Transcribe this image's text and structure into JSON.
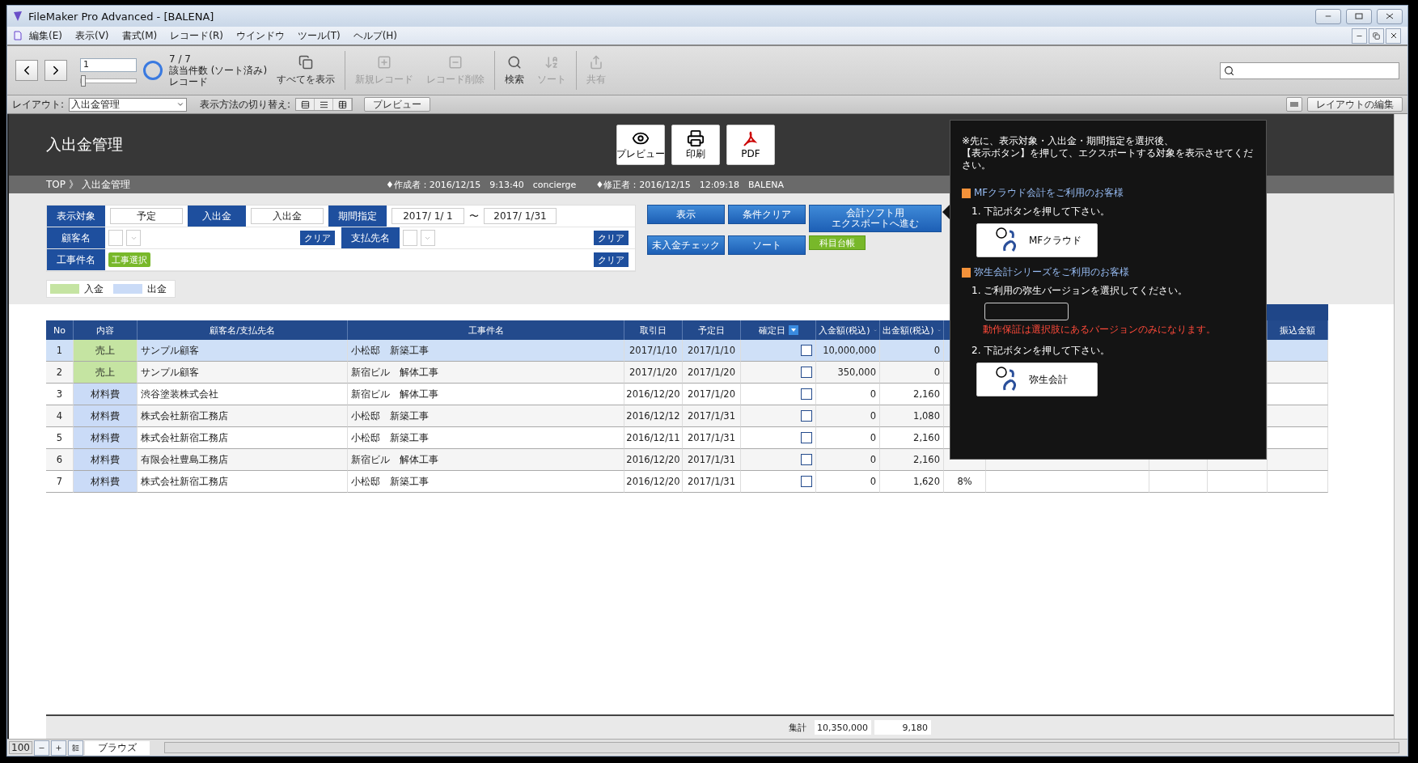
{
  "window": {
    "title": "FileMaker Pro Advanced - [BALENA]"
  },
  "menu": [
    "編集(E)",
    "表示(V)",
    "書式(M)",
    "レコード(R)",
    "ウインドウ",
    "ツール(T)",
    "ヘルプ(H)"
  ],
  "toolbar": {
    "record": "1",
    "slider": {
      "level": 0
    },
    "found": "7 / 7",
    "found_label": "該当件数 (ソート済み)",
    "unit": "レコード",
    "buttons": [
      {
        "kind": "showall",
        "label": "すべてを表示",
        "disabled": false
      },
      {
        "kind": "new",
        "label": "新規レコード",
        "disabled": true
      },
      {
        "kind": "delete",
        "label": "レコード削除",
        "disabled": true
      },
      {
        "kind": "find",
        "label": "検索",
        "disabled": false
      },
      {
        "kind": "sort",
        "label": "ソート",
        "disabled": true
      },
      {
        "kind": "share",
        "label": "共有",
        "disabled": true
      }
    ]
  },
  "layout_bar": {
    "layout_label": "レイアウト:",
    "layout": "入出金管理",
    "view_label": "表示方法の切り替え:",
    "preview": "プレビュー",
    "edit": "レイアウトの編集"
  },
  "header": {
    "title": "入出金管理",
    "actions": [
      {
        "kind": "preview",
        "label": "プレビュー"
      },
      {
        "kind": "print",
        "label": "印刷"
      },
      {
        "kind": "pdf",
        "label": "PDF"
      }
    ]
  },
  "breadcrumb": {
    "path": "TOP 》 入出金管理",
    "created": "♦作成者：2016/12/15　9:13:40　concierge",
    "modified": "♦修正者：2016/12/15　12:09:18　BALENA"
  },
  "filters": {
    "target_label": "表示対象",
    "target": "予定",
    "io_label": "入出金",
    "io": "入出金",
    "period_label": "期間指定",
    "from": "2017/ 1/ 1",
    "tilde": "〜",
    "to": "2017/ 1/31",
    "customer_label": "顧客名",
    "payee_label": "支払先名",
    "project_label": "工事件名",
    "project_button": "工事選択",
    "clear": [
      "クリア",
      "クリア",
      "クリア"
    ]
  },
  "actions": [
    {
      "kind": "blue",
      "lines": [
        "表示"
      ]
    },
    {
      "kind": "blue",
      "lines": [
        "条件クリア"
      ]
    },
    {
      "kind": "wide",
      "lines": [
        "会計ソフト用",
        "エクスポートへ進む"
      ]
    },
    {
      "kind": "blue",
      "lines": [
        "未入金チェック"
      ]
    },
    {
      "kind": "blue",
      "lines": [
        "ソート"
      ]
    },
    {
      "kind": "green",
      "lines": [
        "科目台帳"
      ]
    }
  ],
  "legend": [
    {
      "label": "入金",
      "color": "#c5e4a2"
    },
    {
      "label": "出金",
      "color": "#cadbf7"
    }
  ],
  "table": {
    "columns": [
      "No",
      "内容",
      "顧客名/支払先名",
      "工事件名",
      "取引日",
      "予定日",
      "確定日",
      "入金額(税込)",
      "出金額(税込)"
    ],
    "last_column": "振込金額",
    "rows": [
      {
        "no": "1",
        "type": "売上",
        "color": "#c5e4a2",
        "party": "サンプル顧客",
        "project": "小松邸　新築工事",
        "trade": "2017/1/10",
        "due": "2017/1/10",
        "checked": false,
        "income": "10,000,000",
        "expense": "0",
        "selected": true
      },
      {
        "no": "2",
        "type": "売上",
        "color": "#c5e4a2",
        "party": "サンプル顧客",
        "project": "新宿ビル　解体工事",
        "trade": "2017/1/20",
        "due": "2017/1/20",
        "checked": false,
        "income": "350,000",
        "expense": "0",
        "selected": false
      },
      {
        "no": "3",
        "type": "材料費",
        "color": "#cadbf7",
        "party": "渋谷塗装株式会社",
        "project": "新宿ビル　解体工事",
        "trade": "2016/12/20",
        "due": "2017/1/20",
        "checked": false,
        "income": "0",
        "expense": "2,160",
        "selected": false
      },
      {
        "no": "4",
        "type": "材料費",
        "color": "#cadbf7",
        "party": "株式会社新宿工務店",
        "project": "小松邸　新築工事",
        "trade": "2016/12/12",
        "due": "2017/1/31",
        "checked": false,
        "income": "0",
        "expense": "1,080",
        "selected": false
      },
      {
        "no": "5",
        "type": "材料費",
        "color": "#cadbf7",
        "party": "株式会社新宿工務店",
        "project": "小松邸　新築工事",
        "trade": "2016/12/11",
        "due": "2017/1/31",
        "checked": false,
        "income": "0",
        "expense": "2,160",
        "selected": false
      },
      {
        "no": "6",
        "type": "材料費",
        "color": "#cadbf7",
        "party": "有限会社豊島工務店",
        "project": "新宿ビル　解体工事",
        "trade": "2016/12/20",
        "due": "2017/1/31",
        "checked": false,
        "income": "0",
        "expense": "2,160",
        "selected": false
      },
      {
        "no": "7",
        "type": "材料費",
        "color": "#cadbf7",
        "party": "株式会社新宿工務店",
        "project": "小松邸　新築工事",
        "trade": "2016/12/20",
        "due": "2017/1/31",
        "checked": false,
        "income": "0",
        "expense": "1,620",
        "tax": "8%",
        "selected": false
      }
    ]
  },
  "summary": {
    "label": "集計",
    "income": "10,350,000",
    "expense": "9,180"
  },
  "status_bar": {
    "zoom": "100",
    "mode": "ブラウズ"
  },
  "popover": {
    "note": [
      "※先に、表示対象・入出金・期間指定を選択後、",
      "【表示ボタン】を押して、エクスポートする対象を表示させてください。"
    ],
    "sections": [
      {
        "heading": "MFクラウド会計をご利用のお客様",
        "steps": [
          {
            "kind": "text",
            "text": "1.  下記ボタンを押して下さい。"
          },
          {
            "kind": "button",
            "text": "MFクラウド"
          }
        ]
      },
      {
        "heading": "弥生会計シリーズをご利用のお客様",
        "steps": [
          {
            "kind": "text",
            "text": "1.  ご利用の弥生バージョンを選択してください。"
          },
          {
            "kind": "select"
          },
          {
            "kind": "warning",
            "text": "動作保証は選択肢にあるバージョンのみになります。"
          },
          {
            "kind": "text",
            "text": "2.  下記ボタンを押して下さい。"
          },
          {
            "kind": "button",
            "text": "弥生会計"
          }
        ]
      }
    ]
  }
}
